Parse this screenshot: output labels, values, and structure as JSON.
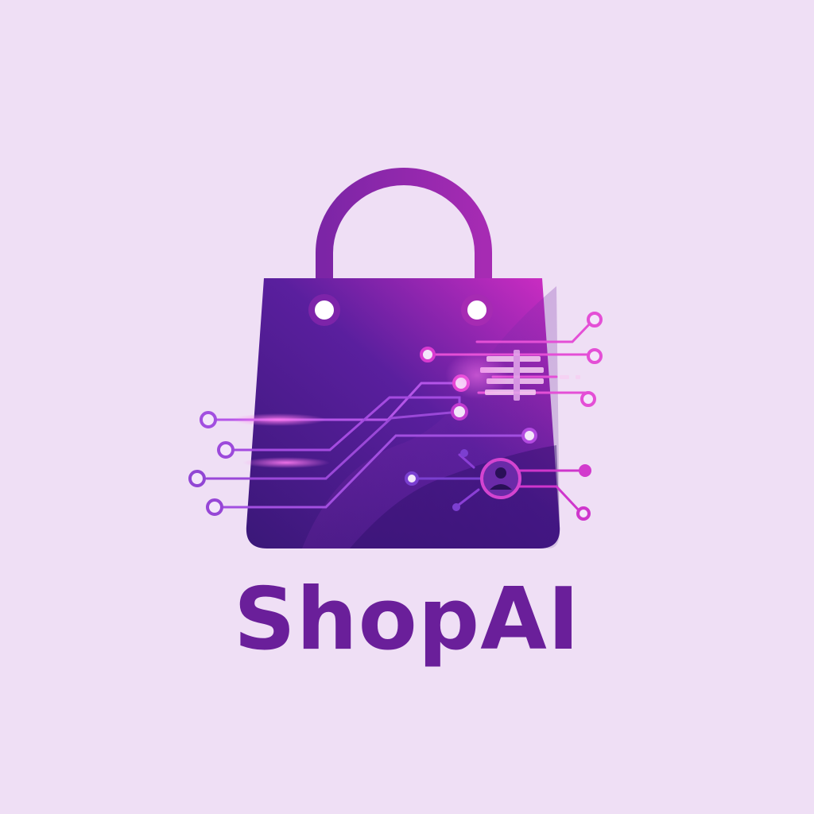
{
  "brand": {
    "name": "ShopAI"
  },
  "colors": {
    "background": "#efdff5",
    "wordmark": "#6a1f9a",
    "bag_dark": "#3f1a80",
    "bag_mid": "#6a22a8",
    "bag_bright": "#c22bc8",
    "circuit": "#a54de0",
    "circuit_hot": "#e33fd2",
    "handle": "#7d24a9"
  },
  "icons": {
    "bag": "shopping-bag-icon",
    "circuit": "circuit-traces-icon",
    "user": "user-avatar-icon"
  }
}
